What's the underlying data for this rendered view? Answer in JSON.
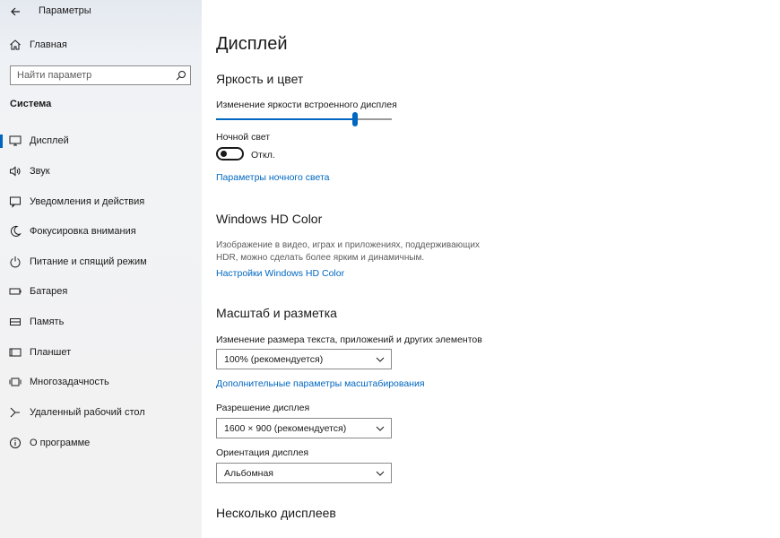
{
  "app": {
    "title": "Параметры"
  },
  "sidebar": {
    "home_label": "Главная",
    "search_placeholder": "Найти параметр",
    "section_title": "Система",
    "items": [
      {
        "label": "Дисплей",
        "icon": "monitor-icon",
        "active": true
      },
      {
        "label": "Звук",
        "icon": "speaker-icon"
      },
      {
        "label": "Уведомления и действия",
        "icon": "notification-icon"
      },
      {
        "label": "Фокусировка внимания",
        "icon": "moon-icon"
      },
      {
        "label": "Питание и спящий режим",
        "icon": "power-icon"
      },
      {
        "label": "Батарея",
        "icon": "battery-icon"
      },
      {
        "label": "Память",
        "icon": "storage-icon"
      },
      {
        "label": "Планшет",
        "icon": "tablet-icon"
      },
      {
        "label": "Многозадачность",
        "icon": "multitasking-icon"
      },
      {
        "label": "Удаленный рабочий стол",
        "icon": "remote-desktop-icon"
      },
      {
        "label": "О программе",
        "icon": "info-icon"
      }
    ]
  },
  "main": {
    "page_title": "Дисплей",
    "brightness": {
      "heading": "Яркость и цвет",
      "slider_label": "Изменение яркости встроенного дисплея",
      "brightness_fraction": 0.79,
      "night_light_label": "Ночной свет",
      "night_light_state": "Откл.",
      "night_light_link": "Параметры ночного света"
    },
    "hdr": {
      "heading": "Windows HD Color",
      "description": "Изображение в видео, играх и приложениях, поддерживающих HDR, можно сделать более ярким и динамичным.",
      "link": "Настройки Windows HD Color"
    },
    "scale": {
      "heading": "Масштаб и разметка",
      "scale_label": "Изменение размера текста, приложений и других элементов",
      "scale_value": "100% (рекомендуется)",
      "advanced_link": "Дополнительные параметры масштабирования",
      "resolution_label": "Разрешение дисплея",
      "resolution_value": "1600 × 900 (рекомендуется)",
      "orientation_label": "Ориентация дисплея",
      "orientation_value": "Альбомная"
    },
    "multi": {
      "heading": "Несколько дисплеев"
    }
  },
  "colors": {
    "accent": "#0067c0",
    "sidebar_bg": "#f2f2f2"
  }
}
